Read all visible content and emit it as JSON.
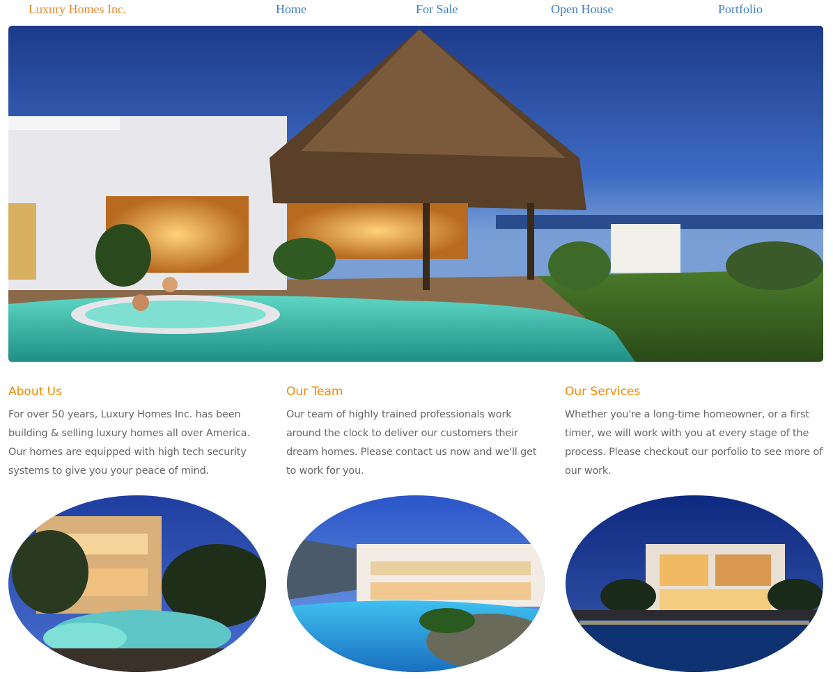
{
  "nav": {
    "brand": "Luxury Homes Inc.",
    "links": [
      "Home",
      "For Sale",
      "Open House",
      "Portfolio"
    ]
  },
  "sections": [
    {
      "title": "About Us",
      "body": "For over 50 years, Luxury Homes Inc. has been building & selling luxury homes all over America. Our homes are equipped with high tech security systems to give you your peace of mind."
    },
    {
      "title": "Our Team",
      "body": "Our team of highly trained professionals work around the clock to deliver our customers their dream homes. Please contact us now and we'll get to work for you."
    },
    {
      "title": "Our Services",
      "body": "Whether you're a long-time homeowner, or a first timer, we will work with you at every stage of the process. Please checkout our porfolio to see more of our work."
    }
  ],
  "colors": {
    "brand": "#e58a2e",
    "link": "#3f7fbf",
    "heading": "#f08a00",
    "text": "#666666"
  }
}
